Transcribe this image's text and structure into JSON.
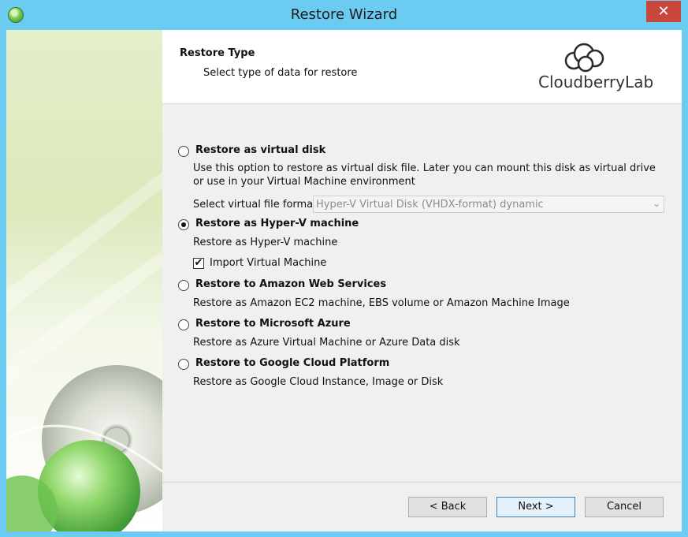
{
  "window": {
    "title": "Restore Wizard",
    "close_glyph": "✕"
  },
  "header": {
    "title": "Restore Type",
    "subtitle": "Select type of data for restore",
    "logo_text": "CloudberryLab"
  },
  "options": [
    {
      "label": "Restore as virtual disk",
      "description": "Use this option to restore as virtual disk file. Later you can mount this disk as virtual drive or use in your Virtual Machine environment",
      "selected": false
    },
    {
      "label": "Restore as Hyper-V machine",
      "description": "Restore as Hyper-V machine",
      "selected": true
    },
    {
      "label": "Restore to Amazon Web Services",
      "description": "Restore as Amazon EC2 machine, EBS volume or Amazon Machine Image",
      "selected": false
    },
    {
      "label": "Restore to Microsoft Azure",
      "description": "Restore as Azure Virtual Machine or Azure Data disk",
      "selected": false
    },
    {
      "label": "Restore to Google Cloud Platform",
      "description": "Restore as Google Cloud Instance, Image or Disk",
      "selected": false
    }
  ],
  "virtual_format": {
    "label": "Select virtual file format:",
    "value": "Hyper-V Virtual Disk (VHDX-format) dynamic",
    "enabled": false
  },
  "import_vm": {
    "label": "Import Virtual Machine",
    "checked": true,
    "check_glyph": "✔"
  },
  "buttons": {
    "back": "< Back",
    "next": "Next >",
    "cancel": "Cancel"
  },
  "colors": {
    "titlebar": "#6ccbf0",
    "close_button": "#c9463d",
    "default_button_border": "#3c7fb1"
  }
}
